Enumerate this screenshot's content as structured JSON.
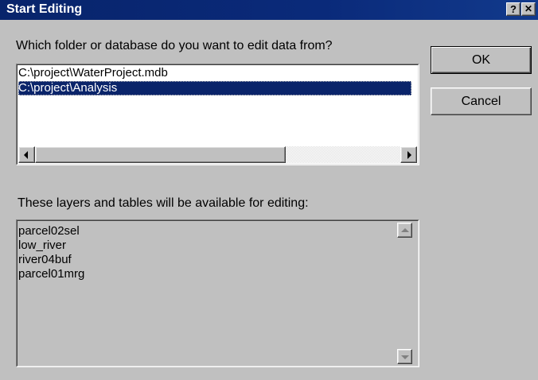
{
  "window": {
    "title": "Start Editing",
    "help_glyph": "?",
    "close_glyph": "✕"
  },
  "folder_prompt": "Which folder or database do you want to edit data from?",
  "folders": [
    {
      "label": "C:\\project\\WaterProject.mdb",
      "selected": false
    },
    {
      "label": "C:\\project\\Analysis",
      "selected": true
    }
  ],
  "layers_prompt": "These layers and tables will be available for editing:",
  "layers": [
    "parcel02sel",
    "low_river",
    "river04buf",
    "parcel01mrg"
  ],
  "buttons": {
    "ok": "OK",
    "cancel": "Cancel"
  },
  "colors": {
    "titlebar": "#0a246a",
    "selection": "#0a246a",
    "face": "#c0c0c0"
  },
  "icons": [
    "help-icon",
    "close-icon",
    "scroll-left-arrow-icon",
    "scroll-right-arrow-icon",
    "scroll-up-arrow-icon",
    "scroll-down-arrow-icon"
  ]
}
